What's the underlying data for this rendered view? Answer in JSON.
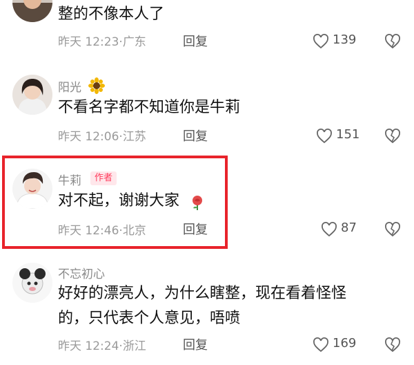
{
  "comments": [
    {
      "username": "",
      "text": "整的不像本人了",
      "time": "昨天 12:23",
      "location": "广东",
      "reply": "回复",
      "likes": "139"
    },
    {
      "username": "阳光",
      "text": "不看名字都不知道你是牛莉",
      "time": "昨天 12:06",
      "location": "江苏",
      "reply": "回复",
      "likes": "151"
    },
    {
      "username": "牛莉",
      "badge": "作者",
      "text": "对不起，谢谢大家",
      "time": "昨天 12:46",
      "location": "北京",
      "reply": "回复",
      "likes": "87"
    },
    {
      "username": "不忘初心",
      "text_line1": "好好的漂亮人，为什么瞎整，现在看着怪怪",
      "text_line2": "的，只代表个人意见，唔喷",
      "time": "昨天 12:24",
      "location": "浙江",
      "reply": "回复",
      "likes": "169"
    }
  ],
  "separator": "·",
  "colors": {
    "highlight": "#e8232b",
    "badge_text": "#ff3b5c",
    "badge_bg": "#ffe7eb",
    "meta": "#9a9a9a"
  },
  "icons": [
    "heart-outline-icon",
    "broken-heart-icon",
    "sunflower-icon",
    "rose-icon"
  ]
}
